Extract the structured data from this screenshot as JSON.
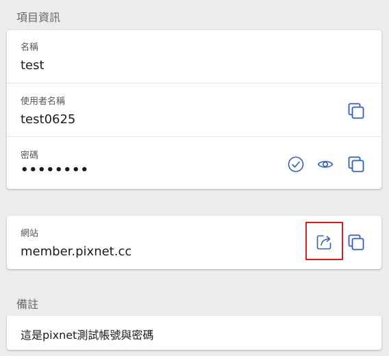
{
  "sections": {
    "item_info_title": "項目資訊",
    "notes_title": "備註"
  },
  "fields": {
    "name": {
      "label": "名稱",
      "value": "test"
    },
    "username": {
      "label": "使用者名稱",
      "value": "test0625"
    },
    "password": {
      "label": "密碼",
      "value": "••••••••"
    },
    "website": {
      "label": "網站",
      "value": "member.pixnet.cc"
    }
  },
  "notes": {
    "value": "這是pixnet測試帳號與密碼"
  },
  "icons": {
    "copy": "copy-icon",
    "check": "check-circle-icon",
    "eye": "eye-icon",
    "open_external": "open-external-icon"
  },
  "colors": {
    "icon_blue": "#2f5fb8",
    "highlight_red": "#e01b1b"
  }
}
